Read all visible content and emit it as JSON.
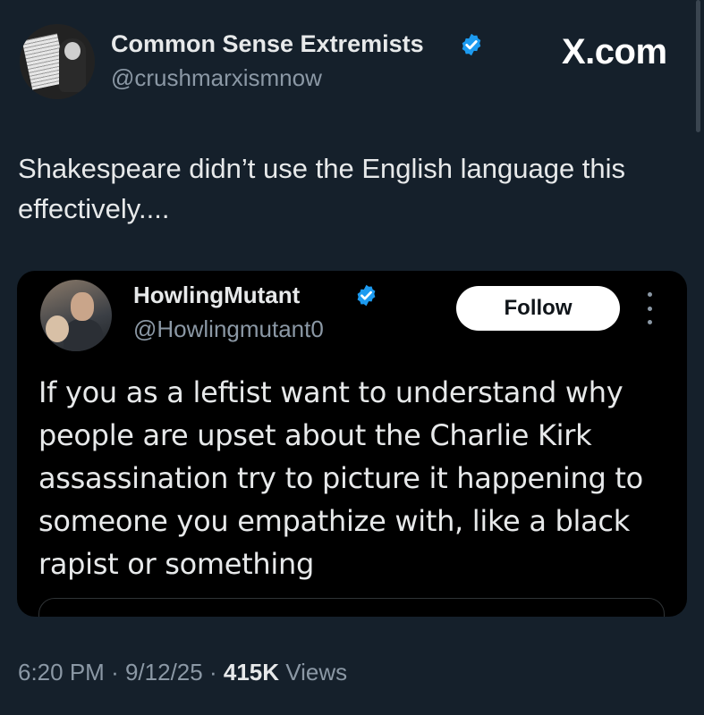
{
  "header": {
    "display_name": "Common Sense Extremists",
    "handle": "@crushmarxismnow",
    "verified_icon": "verified-badge-icon",
    "brand": "X.com"
  },
  "post": {
    "text": "Shakespeare didn’t use the English language this effectively...."
  },
  "quoted": {
    "display_name": "HowlingMutant",
    "handle": "@Howlingmutant0",
    "follow_label": "Follow",
    "more_icon": "more-options-icon",
    "text": "If you as a leftist want to understand why people are upset about the Charlie Kirk assassination try to picture it happening to someone you empathize with, like a black rapist or something"
  },
  "meta": {
    "time": "6:20 PM",
    "date": "9/12/25",
    "views_count": "415K",
    "views_label": "Views",
    "separator": "·"
  },
  "colors": {
    "background": "#15202b",
    "card_background": "#000000",
    "verified": "#1d9bf0",
    "text_primary": "#e7e9ea",
    "text_secondary": "#8b98a5"
  }
}
